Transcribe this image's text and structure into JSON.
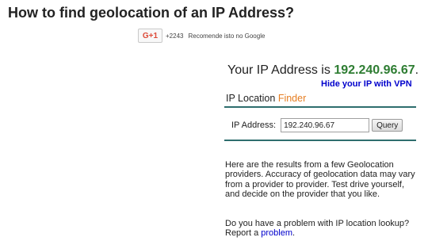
{
  "page": {
    "title": "How to find geolocation of an IP Address?"
  },
  "gplus": {
    "button_label": "G+1",
    "count": "+2243",
    "recommend_text": "Recomende isto no Google",
    "icon": "google-plus-icon"
  },
  "ip_info": {
    "prefix": "Your IP Address is",
    "ip": "192.240.96.67",
    "hide_link": "Hide your IP with VPN"
  },
  "finder": {
    "title_main": "IP Location",
    "title_accent": "Finder",
    "field_label": "IP Address:",
    "field_value": "192.240.96.67",
    "query_button": "Query"
  },
  "results": {
    "paragraph": "Here are the results from a few Geolocation providers. Accuracy of geolocation data may vary from a provider to provider. Test drive yourself, and decide on the provider that you like.",
    "problem_text": "Do you have a problem with IP location lookup? Report a",
    "problem_link": "problem",
    "problem_end": "."
  },
  "colors": {
    "ip_green": "#2e7d32",
    "link_blue": "#0000cc",
    "accent_orange": "#e67e22",
    "divider_teal": "#2e6e6e"
  }
}
